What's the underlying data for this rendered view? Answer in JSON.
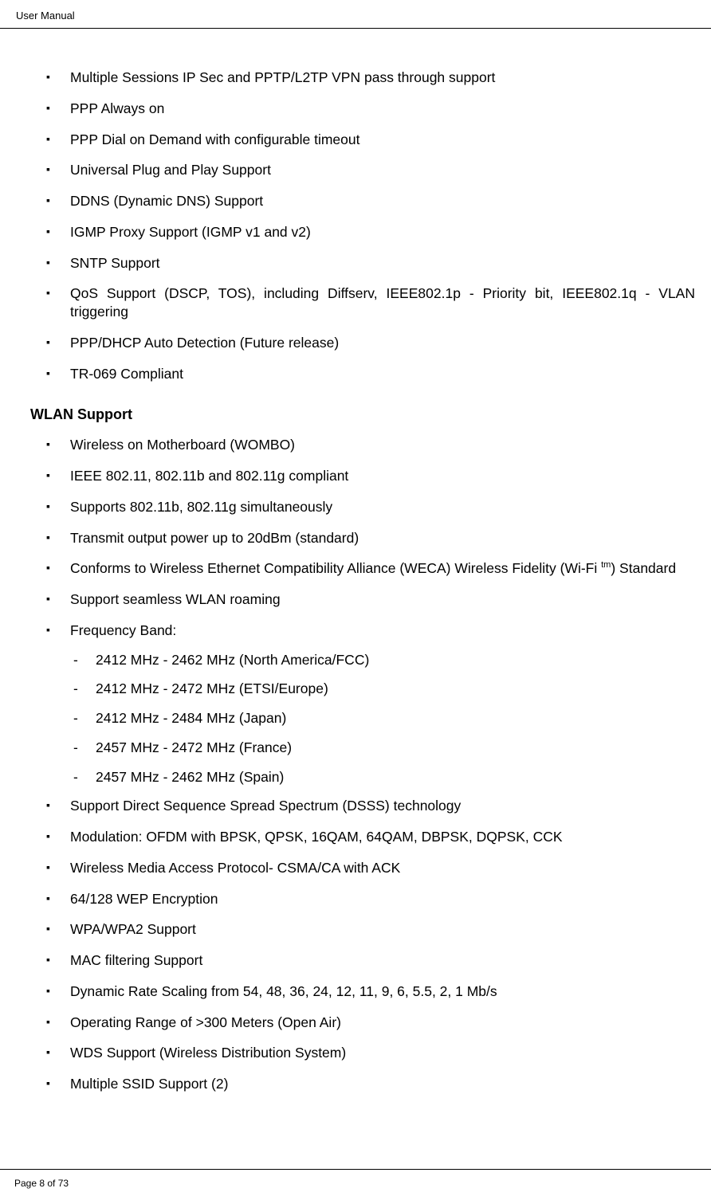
{
  "header": {
    "title": "User Manual"
  },
  "footer": {
    "page": "Page 8 of 73"
  },
  "section1": {
    "items": [
      "Multiple Sessions IP Sec and PPTP/L2TP VPN pass through support",
      "PPP Always on",
      "PPP Dial on Demand with configurable timeout",
      "Universal Plug and Play Support",
      "DDNS (Dynamic DNS) Support",
      "IGMP Proxy Support (IGMP v1 and v2)",
      "SNTP Support",
      "QoS Support (DSCP, TOS), including Diffserv, IEEE802.1p - Priority bit, IEEE802.1q - VLAN triggering",
      "PPP/DHCP Auto Detection (Future release)",
      "TR-069 Compliant"
    ]
  },
  "section2": {
    "heading": "WLAN Support",
    "items_a": [
      "Wireless on Motherboard (WOMBO)",
      "IEEE 802.11, 802.11b and 802.11g compliant",
      "Supports 802.11b, 802.11g simultaneously",
      "Transmit output power up to 20dBm (standard)"
    ],
    "weca_pre": "Conforms to Wireless Ethernet Compatibility Alliance (WECA) Wireless Fidelity (Wi-Fi ",
    "weca_tm": "tm",
    "weca_post": ") Standard",
    "items_b": [
      "Support seamless WLAN roaming",
      "Frequency Band:"
    ],
    "freq": [
      "2412 MHz - 2462 MHz (North America/FCC)",
      "2412 MHz - 2472 MHz (ETSI/Europe)",
      "2412 MHz - 2484 MHz (Japan)",
      "2457 MHz - 2472 MHz (France)",
      "2457 MHz - 2462 MHz (Spain)"
    ],
    "items_c": [
      "Support Direct Sequence Spread Spectrum (DSSS) technology",
      "Modulation: OFDM with BPSK, QPSK, 16QAM, 64QAM, DBPSK, DQPSK, CCK",
      "Wireless Media Access Protocol- CSMA/CA with ACK",
      "64/128 WEP Encryption",
      "WPA/WPA2 Support",
      "MAC filtering Support",
      "Dynamic Rate Scaling from 54, 48, 36, 24, 12, 11, 9, 6, 5.5, 2, 1 Mb/s",
      "Operating Range of >300 Meters (Open Air)",
      "WDS Support (Wireless Distribution System)",
      "Multiple SSID Support (2)"
    ]
  }
}
